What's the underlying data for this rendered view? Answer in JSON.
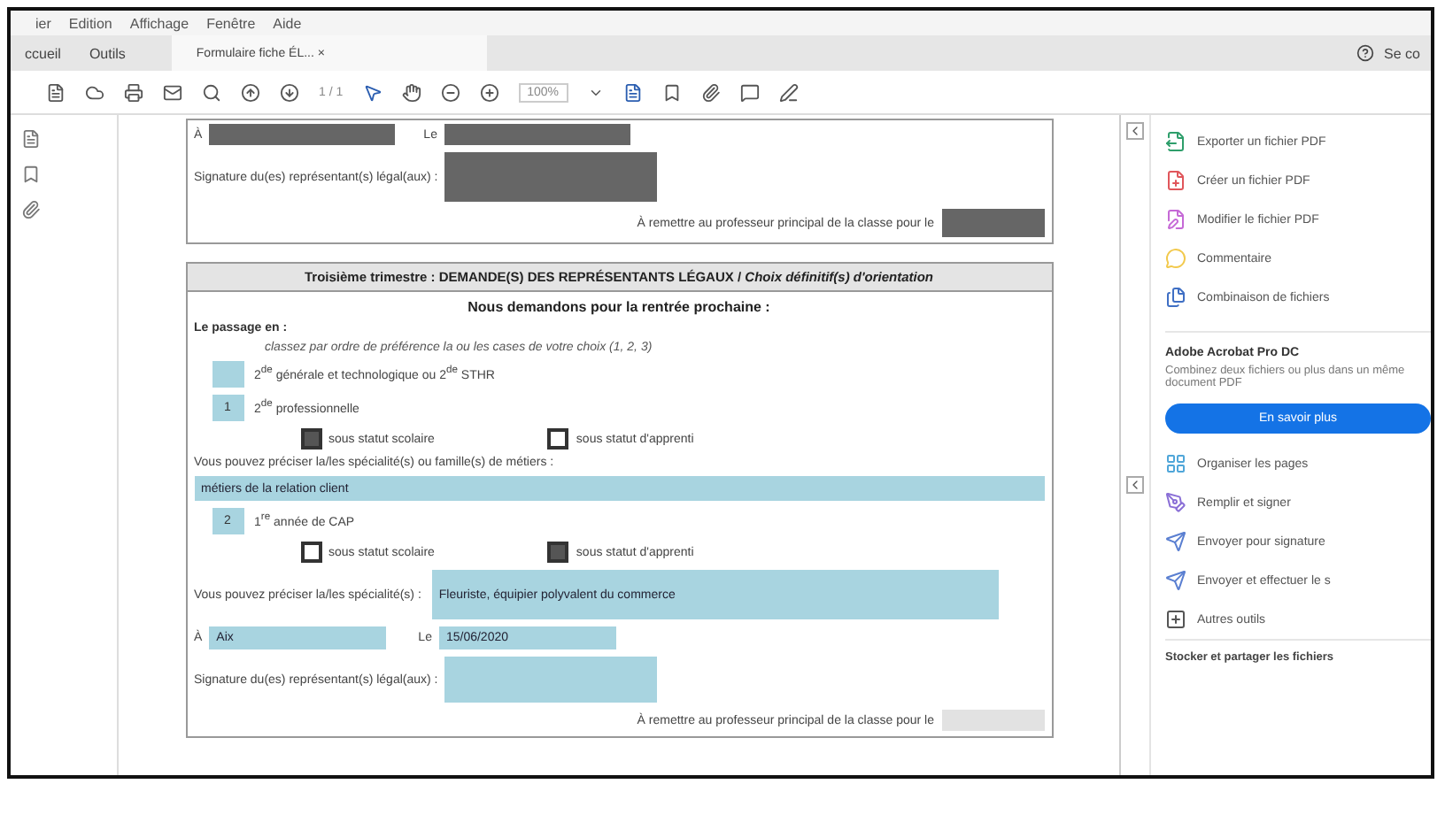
{
  "menu": [
    "ier",
    "Edition",
    "Affichage",
    "Fenêtre",
    "Aide"
  ],
  "tabs": [
    {
      "label": "ccueil",
      "selected": false,
      "kind": "nav"
    },
    {
      "label": "Outils",
      "selected": false,
      "kind": "nav"
    },
    {
      "label": "Formulaire fiche ÉL...",
      "close": "×",
      "selected": true,
      "kind": "document"
    }
  ],
  "account": "Se co",
  "toolbar": {
    "page": "1 / 1",
    "zoom": "100%"
  },
  "form": {
    "top": {
      "place_label": "À",
      "date_label": "Le",
      "signature_label": "Signature du(es) représentant(s) légal(aux) :",
      "deadline_label": "À remettre au professeur principal de la classe pour le"
    },
    "title": "Troisième trimestre : DEMANDE(S) DES REPRÉSENTANTS LÉGAUX / *Choix définitif(s) d'orientation*",
    "subtitle": "Nous demandons pour la rentrée prochaine :",
    "passage_label": "Le passage en :",
    "hint": "classez par ordre de préférence la ou les cases de votre choix (1, 2, 3)",
    "options": [
      {
        "label": "2$^{de}$ générale et technologique ou 2$^{de}$ STHR"
      },
      {
        "rank": "1",
        "label": "2$^{de}$ professionnelle",
        "statuses": [
          {
            "label": "sous statut scolaire",
            "checked": true
          },
          {
            "label": "sous statut d'apprenti",
            "checked": false
          }
        ],
        "detail_label": "Vous pouvez préciser la/les spécialité(s) ou famille(s) de métiers :",
        "detail_value": "métiers de la relation client",
        "kind": "block"
      },
      {
        "rank": "2",
        "label": "1$^{re}$ année de CAP",
        "statuses": [
          {
            "label": "sous statut scolaire",
            "checked": false
          },
          {
            "label": "sous statut d'apprenti",
            "checked": true
          }
        ],
        "detail_label": "Vous pouvez préciser la/les spécialité(s) :",
        "detail_value": "Fleuriste, équipier polyvalent du commerce",
        "kind": "inline"
      }
    ],
    "place_label": "À",
    "place_value": "Aix",
    "date_label": "Le",
    "date_value": "15/06/2020",
    "signature_label": "Signature du(es) représentant(s) légal(aux) :",
    "deadline_label": "À remettre au professeur principal de la classe pour le"
  },
  "tools": [
    {
      "label": "Exporter un fichier PDF",
      "color": "#2e9e6b"
    },
    {
      "label": "Créer un fichier PDF",
      "color": "#e0565b"
    },
    {
      "label": "Modifier le fichier PDF",
      "color": "#c569d6"
    },
    {
      "label": "Commentaire",
      "color": "#f2c94c"
    },
    {
      "label": "Combinaison de fichiers",
      "color": "#3f6fc4"
    }
  ],
  "promo": {
    "title": "Adobe Acrobat Pro DC",
    "text": "Combinez deux fichiers ou plus dans un même document PDF",
    "button": "En savoir plus"
  },
  "more_tools": [
    {
      "label": "Organiser les pages",
      "color": "#4fa6d9"
    },
    {
      "label": "Remplir et signer",
      "color": "#8a6fd6"
    },
    {
      "label": "Envoyer pour signature",
      "color": "#5a7fd1"
    },
    {
      "label": "Envoyer et effectuer le s",
      "color": "#5a7fd1"
    },
    {
      "label": "Autres outils",
      "color": "#555555"
    }
  ],
  "cloud": "Stocker et partager les fichiers"
}
